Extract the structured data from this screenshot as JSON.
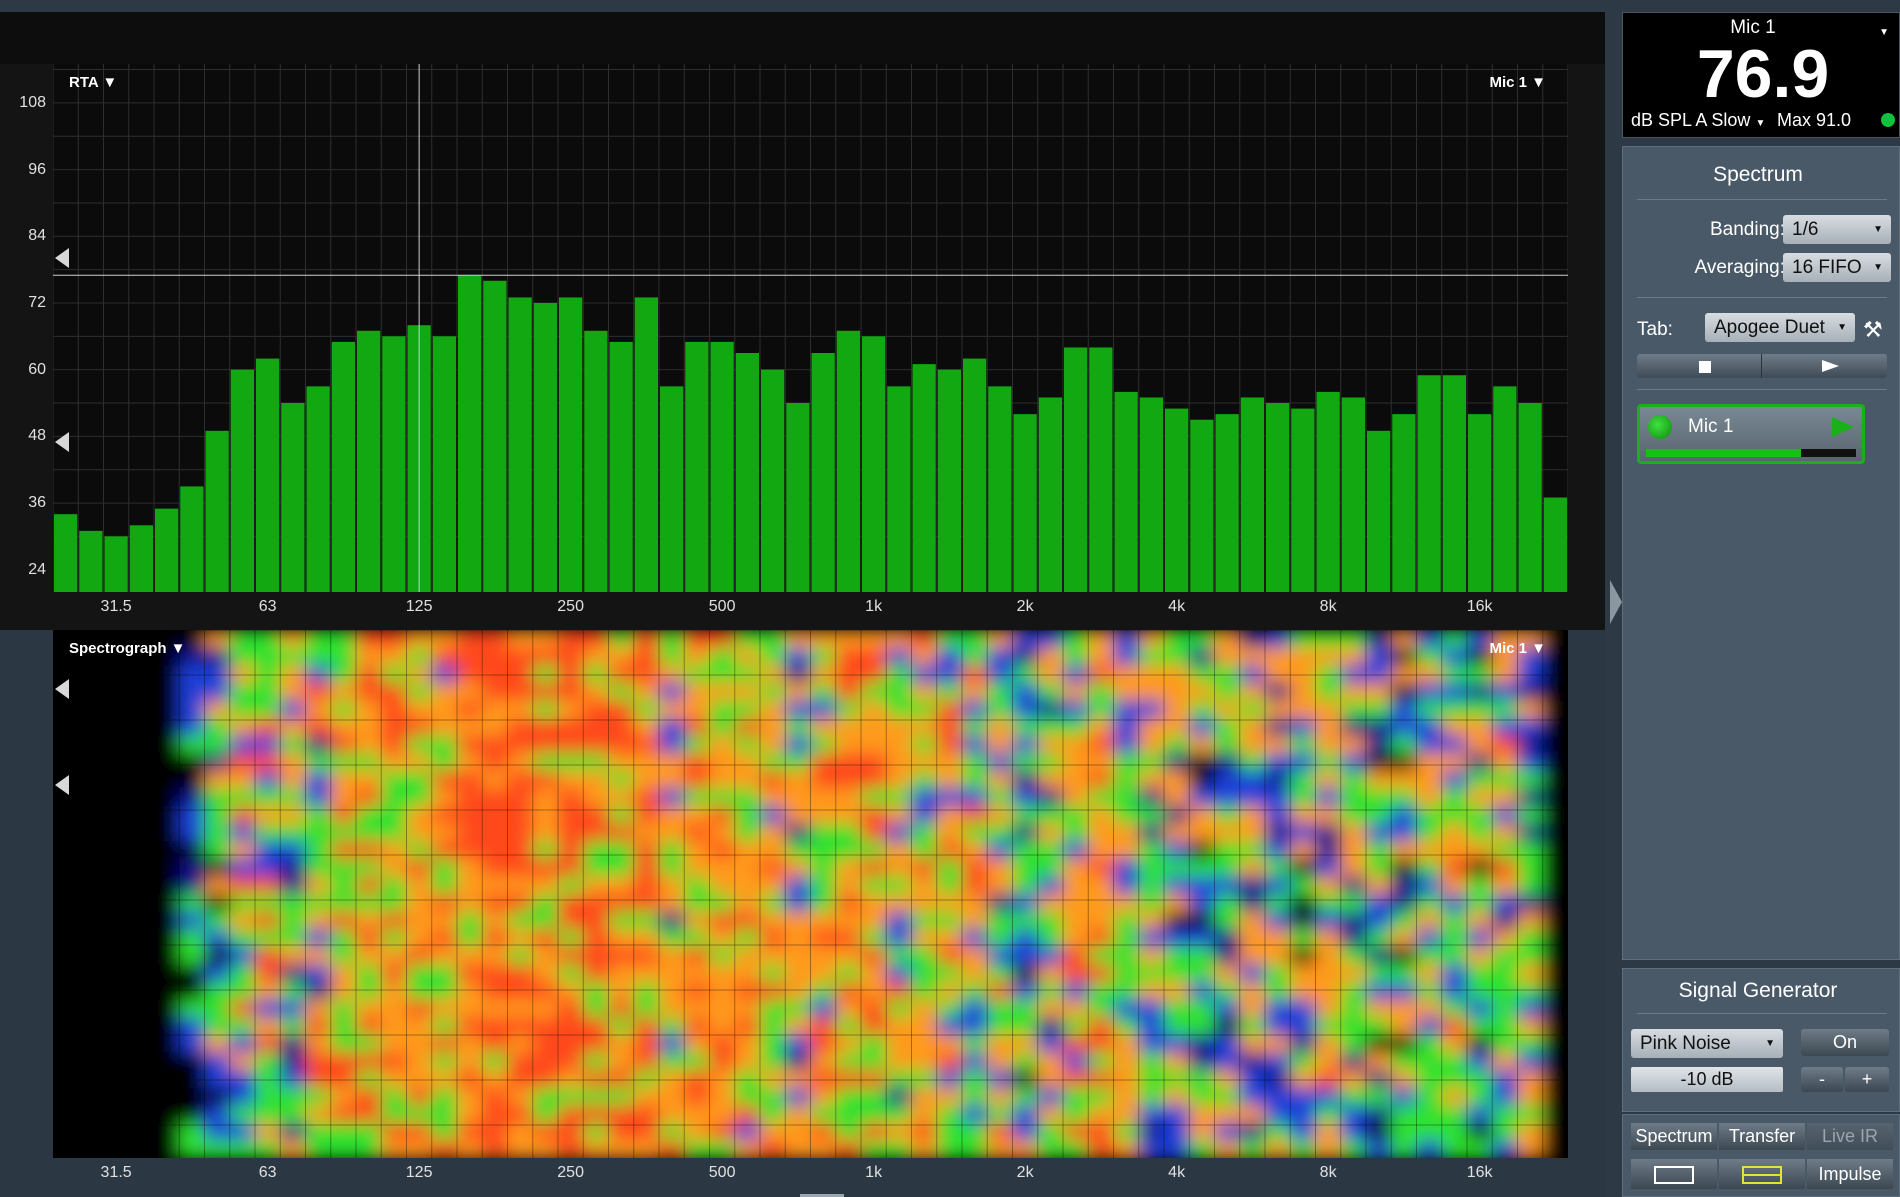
{
  "rta": {
    "title": "RTA",
    "mic_label": "Mic 1",
    "y_ticks": [
      "108",
      "96",
      "84",
      "72",
      "60",
      "48",
      "36",
      "24"
    ],
    "x_ticks": [
      "31.5",
      "63",
      "125",
      "250",
      "500",
      "1k",
      "2k",
      "4k",
      "8k",
      "16k"
    ]
  },
  "spectrograph": {
    "title": "Spectrograph",
    "mic_label": "Mic 1",
    "x_ticks": [
      "31.5",
      "63",
      "125",
      "250",
      "500",
      "1k",
      "2k",
      "4k",
      "8k",
      "16k"
    ]
  },
  "meter": {
    "mic": "Mic 1",
    "value": "76.9",
    "unit": "dB SPL A Slow",
    "max": "Max 91.0"
  },
  "spectrum_panel": {
    "heading": "Spectrum",
    "banding_label": "Banding:",
    "banding_value": "1/6",
    "averaging_label": "Averaging:",
    "averaging_value": "16 FIFO",
    "tab_label": "Tab:",
    "tab_value": "Apogee Duet",
    "mic_card_name": "Mic 1"
  },
  "signal_generator": {
    "heading": "Signal Generator",
    "type": "Pink Noise",
    "on_label": "On",
    "level": "-10 dB",
    "minus": "-",
    "plus": "+"
  },
  "modes": {
    "spectrum": "Spectrum",
    "transfer": "Transfer",
    "live_ir": "Live IR",
    "impulse": "Impulse"
  },
  "colors": {
    "bar": "#12a812",
    "accent_green": "#19b019"
  },
  "chart_data": {
    "type": "bar",
    "title": "RTA",
    "xlabel": "",
    "ylabel": "",
    "ylim": [
      20,
      115
    ],
    "x_scale": "log (1/6 octave bands)",
    "grid": true,
    "cursor_level": 77,
    "categories": [
      "25",
      "28",
      "31.5",
      "35.5",
      "40",
      "45",
      "50",
      "56",
      "63",
      "71",
      "80",
      "90",
      "100",
      "112",
      "125",
      "140",
      "160",
      "180",
      "200",
      "224",
      "250",
      "280",
      "315",
      "355",
      "400",
      "450",
      "500",
      "560",
      "630",
      "710",
      "800",
      "900",
      "1k",
      "1.12k",
      "1.25k",
      "1.4k",
      "1.6k",
      "1.8k",
      "2k",
      "2.24k",
      "2.5k",
      "2.8k",
      "3.15k",
      "3.55k",
      "4k",
      "4.5k",
      "5k",
      "5.6k",
      "6.3k",
      "7.1k",
      "8k",
      "9k",
      "10k",
      "11.2k",
      "12.5k",
      "14k",
      "16k",
      "18k",
      "20k",
      "22.4k"
    ],
    "values": [
      34,
      31,
      30,
      32,
      35,
      39,
      49,
      60,
      62,
      54,
      57,
      65,
      67,
      66,
      68,
      66,
      77,
      76,
      73,
      72,
      73,
      67,
      65,
      73,
      57,
      65,
      65,
      63,
      60,
      54,
      63,
      67,
      66,
      57,
      61,
      60,
      62,
      57,
      52,
      55,
      64,
      64,
      56,
      55,
      53,
      51,
      52,
      55,
      54,
      53,
      56,
      55,
      49,
      52,
      59,
      59,
      52,
      57,
      54,
      37
    ]
  }
}
